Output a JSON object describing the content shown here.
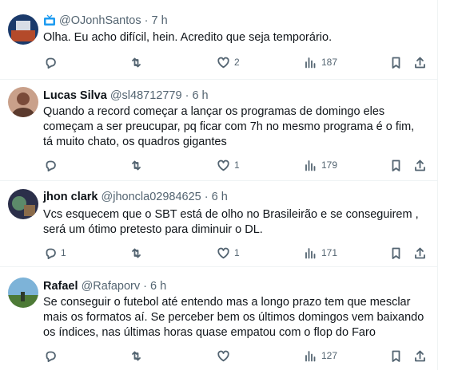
{
  "tweets": [
    {
      "name": "",
      "handle": "@OJonhSantos",
      "time": "7 h",
      "text": "Olha. Eu acho difícil, hein. Acredito que seja temporário.",
      "replies": "",
      "likes": "2",
      "views": "187",
      "avatar_colors": [
        "#1b3a6b",
        "#b44a2a"
      ]
    },
    {
      "name": "Lucas Silva",
      "handle": "@sl48712779",
      "time": "6 h",
      "text": "Quando a record começar a lançar os programas de domingo eles começam a ser preucupar, pq ficar com 7h no mesmo programa é o fim, tá muito chato, os quadros gigantes",
      "replies": "",
      "likes": "1",
      "views": "179",
      "avatar_colors": [
        "#c9a08a",
        "#7a4b3a"
      ]
    },
    {
      "name": "jhon clark",
      "handle": "@jhoncla02984625",
      "time": "6 h",
      "text": "Vcs esquecem que o SBT está de olho no Brasileirão e se conseguirem , será um ótimo pretesto para diminuir o DL.",
      "replies": "1",
      "likes": "1",
      "views": "171",
      "avatar_colors": [
        "#2b2f4a",
        "#5c8a6a"
      ]
    },
    {
      "name": "Rafael",
      "handle": "@Rafaporv",
      "time": "6 h",
      "text": "Se conseguir o futebol até entendo mas a longo prazo tem que mesclar mais os formatos aí. Se perceber bem os últimos domingos vem baixando os índices, nas últimas horas quase empatou com o flop do Faro",
      "replies": "",
      "likes": "",
      "views": "127",
      "avatar_colors": [
        "#7db3d8",
        "#4d7a36"
      ]
    }
  ],
  "icons": {
    "verified_tv": "tv-icon",
    "reply": "reply-icon",
    "retweet": "retweet-icon",
    "like": "heart-icon",
    "views": "views-icon",
    "bookmark": "bookmark-icon",
    "share": "share-icon"
  },
  "colors": {
    "text_primary": "#0f1419",
    "text_secondary": "#536471",
    "divider": "#eff3f4",
    "accent": "#1d9bf0"
  }
}
